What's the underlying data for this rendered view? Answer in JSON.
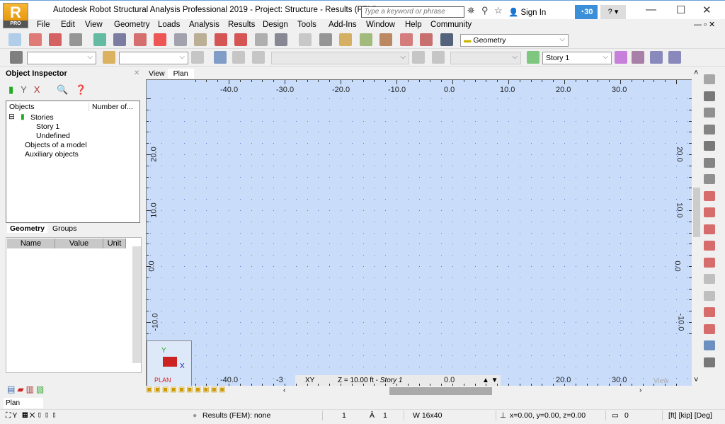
{
  "app": {
    "logo": "R",
    "edition": "PRO",
    "title": "Autodesk Robot Structural Analysis Professional 2019 - Project: Structure - Results (FEM): none",
    "search_placeholder": "Type a keyword or phrase",
    "sign_in": "Sign In",
    "trial_days": "30",
    "help": "?"
  },
  "menu": [
    "File",
    "Edit",
    "View",
    "Geometry",
    "Loads",
    "Analysis",
    "Results",
    "Design",
    "Tools",
    "Add-Ins",
    "Window",
    "Help",
    "Community"
  ],
  "toolbar": {
    "layout_combo": "Geometry",
    "story_combo": "Story 1"
  },
  "inspector": {
    "title": "Object Inspector",
    "col_objects": "Objects",
    "col_number": "Number of...",
    "tree": [
      "Stories",
      "Story 1",
      "Undefined",
      "Objects of a model",
      "Auxiliary objects"
    ],
    "tabs": [
      "Geometry",
      "Groups"
    ],
    "props_headers": [
      "Name",
      "Value",
      "Unit"
    ]
  },
  "view": {
    "tabs": [
      "View",
      "Plan"
    ],
    "x_ticks": [
      "-40.0",
      "-30.0",
      "-20.0",
      "-10.0",
      "0.0",
      "10.0",
      "20.0",
      "30.0"
    ],
    "y_ticks": [
      "20.0",
      "10.0",
      "0.0",
      "-10.0"
    ],
    "bottom_ticks": [
      "-40.0",
      "-3",
      "0.0",
      "20.0",
      "30.0"
    ],
    "plane": "XY",
    "level": "Z = 10.00 ft",
    "story": "Story 1",
    "view_label": "View",
    "axis_label": "PLAN",
    "axes": {
      "x": "X",
      "y": "Y"
    }
  },
  "plan_tab": "Plan",
  "status": {
    "results": "Results (FEM): none",
    "field1": "1",
    "field2": "1",
    "section": "W 16x40",
    "coords": "x=0.00, y=0.00, z=0.00",
    "count": "0",
    "units": "[ft] [kip] [Deg]"
  },
  "colors": {
    "canvas": "#c9ddfb",
    "grid_dot": "#6a78d8",
    "accent": "#3b8fd9"
  }
}
